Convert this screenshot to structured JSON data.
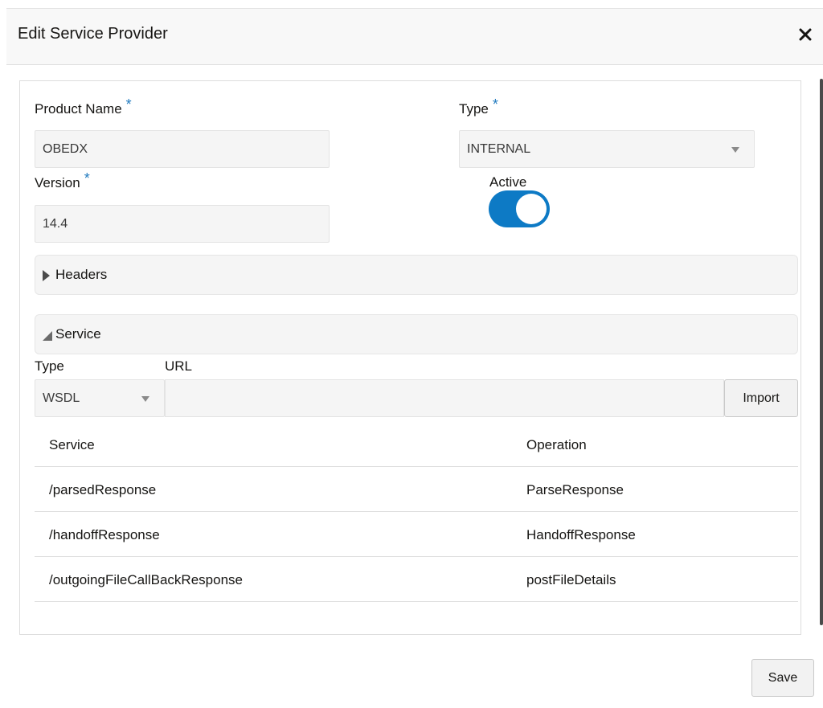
{
  "dialog": {
    "title": "Edit Service Provider",
    "close_glyph": "✕"
  },
  "form": {
    "product_name_label": "Product Name",
    "product_name_value": "OBEDX",
    "type_label": "Type",
    "type_value": "INTERNAL",
    "version_label": "Version",
    "version_value": "14.4",
    "active_label": "Active",
    "active_on": true,
    "required_marker": "*"
  },
  "headers_section": {
    "label": "Headers",
    "expanded": false
  },
  "service_section": {
    "label": "Service",
    "expanded": true,
    "type_label": "Type",
    "type_value": "WSDL",
    "url_label": "URL",
    "url_value": "",
    "import_label": "Import",
    "table": {
      "columns": [
        "Service",
        "Operation"
      ],
      "rows": [
        [
          "/parsedResponse",
          "ParseResponse"
        ],
        [
          "/handoffResponse",
          "HandoffResponse"
        ],
        [
          "/outgoingFileCallBackResponse",
          "postFileDetails"
        ]
      ]
    }
  },
  "footer": {
    "save_label": "Save"
  },
  "colors": {
    "accent": "#0d7ac5",
    "required": "#227bbf"
  }
}
